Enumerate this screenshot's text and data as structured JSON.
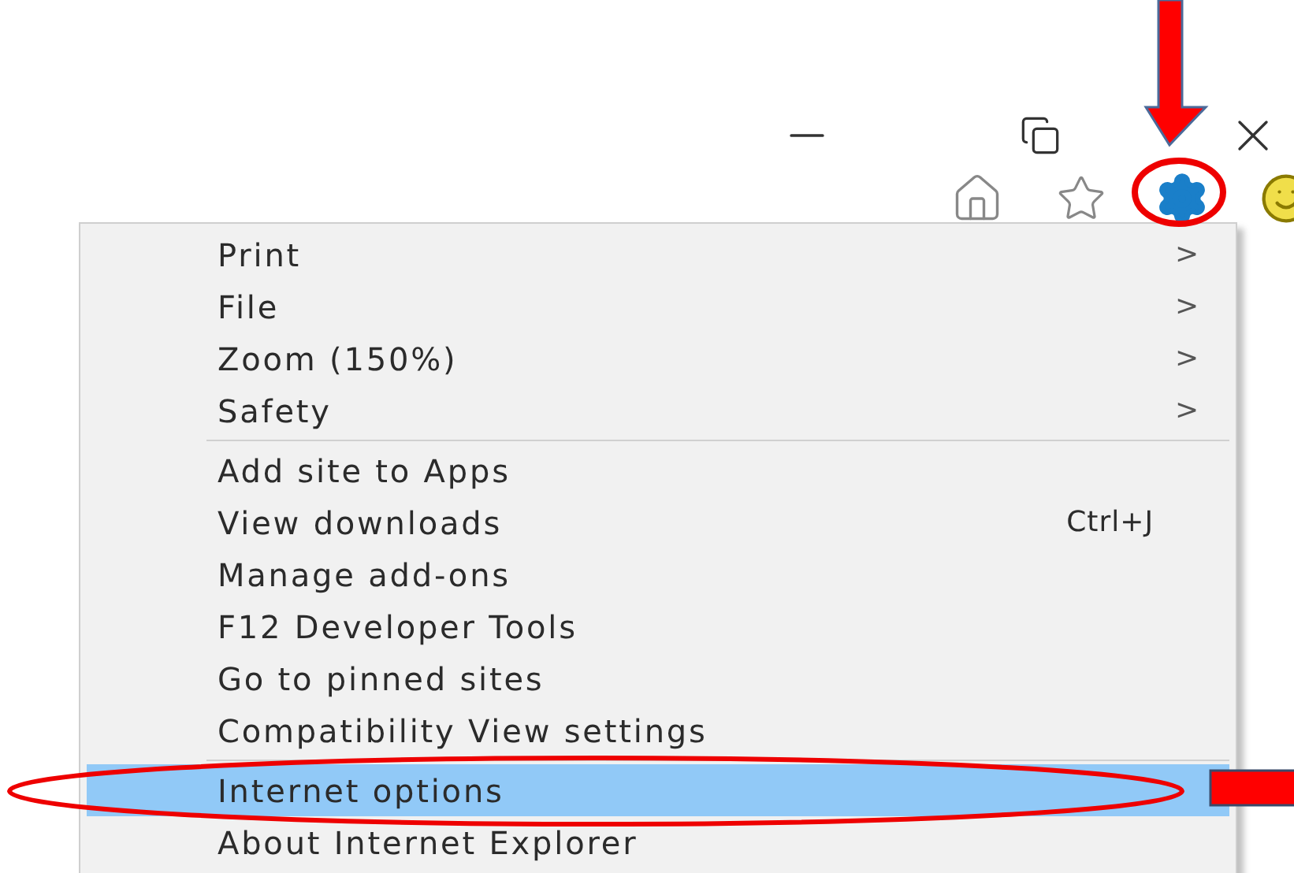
{
  "menu": {
    "groups": [
      {
        "items": [
          {
            "label": "Print",
            "submenu": ">",
            "selected": false
          },
          {
            "label": "File",
            "submenu": ">",
            "selected": false
          },
          {
            "label": "Zoom (150%)",
            "submenu": ">",
            "selected": false
          },
          {
            "label": "Safety",
            "submenu": ">",
            "selected": false
          }
        ]
      },
      {
        "items": [
          {
            "label": "Add site to Apps",
            "selected": false
          },
          {
            "label": "View downloads",
            "shortcut": "Ctrl+J",
            "selected": false
          },
          {
            "label": "Manage add-ons",
            "selected": false
          },
          {
            "label": "F12 Developer Tools",
            "selected": false
          },
          {
            "label": "Go to pinned sites",
            "selected": false
          },
          {
            "label": "Compatibility View settings",
            "selected": false
          }
        ]
      },
      {
        "items": [
          {
            "label": "Internet options",
            "selected": true
          },
          {
            "label": "About Internet Explorer",
            "selected": false
          }
        ]
      }
    ]
  }
}
